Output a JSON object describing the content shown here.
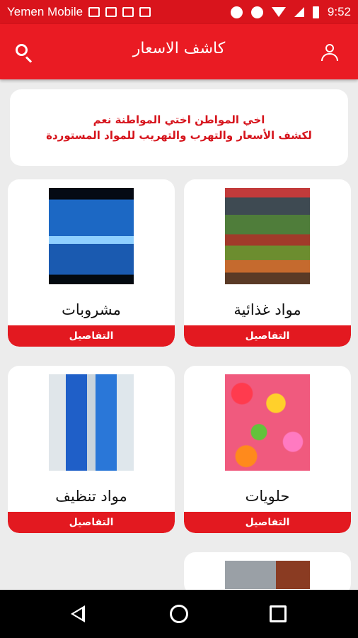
{
  "status_bar": {
    "carrier": "Yemen Mobile",
    "time": "9:52"
  },
  "app_bar": {
    "title": "كاشف الاسعار",
    "search_icon": "search-icon",
    "user_icon": "user-icon"
  },
  "banner": {
    "line1": "اخي المواطن اختي المواطنة نعم",
    "line2": "لكشف الأسعار والتهرب والتهريب للمواد المستوردة"
  },
  "categories": [
    {
      "title": "مواد غذائية",
      "details_label": "التفاصيل"
    },
    {
      "title": "مشروبات",
      "details_label": "التفاصيل"
    },
    {
      "title": "حلويات",
      "details_label": "التفاصيل"
    },
    {
      "title": "مواد تنظيف",
      "details_label": "التفاصيل"
    }
  ],
  "colors": {
    "primary": "#ea1b23",
    "status_bar": "#d9141c",
    "banner_text": "#d6141c",
    "background": "#ececec"
  }
}
